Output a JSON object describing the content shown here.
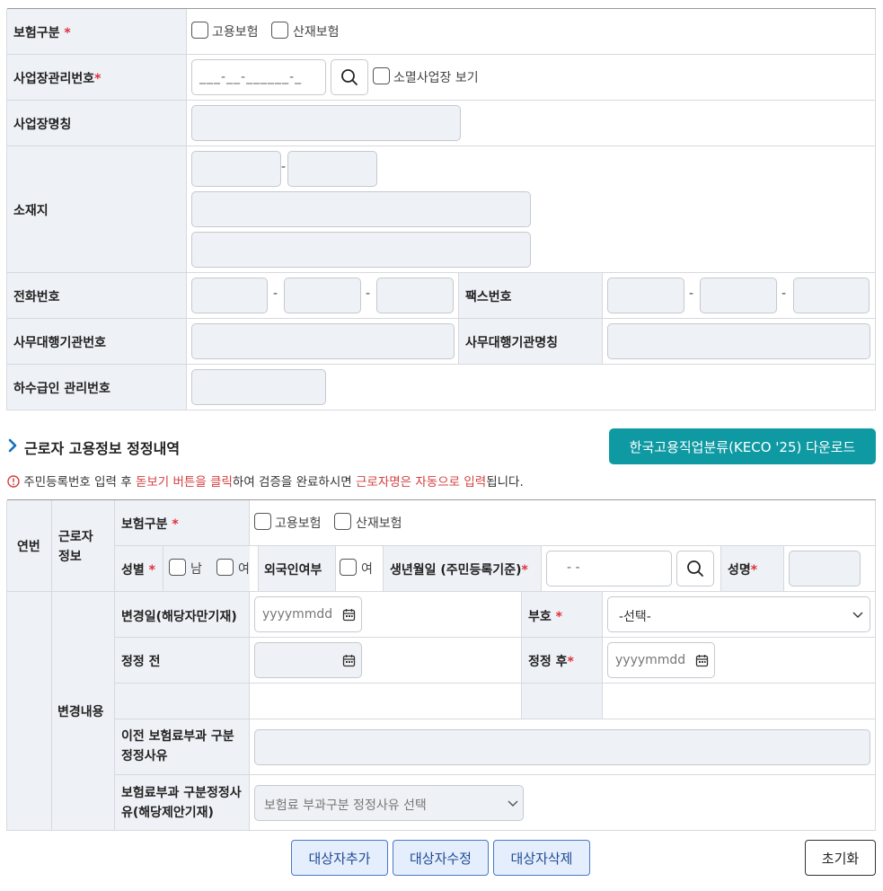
{
  "company": {
    "insurance_type_label": "보험구분",
    "insurance_option_employment": "고용보험",
    "insurance_option_accident": "산재보험",
    "mgmt_no_label": "사업장관리번호",
    "mgmt_no_placeholder": "___-__-______-_",
    "show_closed_label": "소멸사업장 보기",
    "name_label": "사업장명칭",
    "address_label": "소재지",
    "phone_label": "전화번호",
    "fax_label": "팩스번호",
    "agency_no_label": "사무대행기관번호",
    "agency_name_label": "사무대행기관명칭",
    "sub_mgmt_label": "하수급인 관리번호",
    "dash": "-"
  },
  "section": {
    "title": "근로자 고용정보 정정내역",
    "download_button": "한국고용직업분류(KECO '25) 다운로드",
    "notice_1": "주민등록번호 입력 후 ",
    "notice_2": "돋보기 버튼을 클릭",
    "notice_3": "하여 검증을 완료하시면 ",
    "notice_4": "근로자명은 자동으로 입력",
    "notice_5": "됩니다."
  },
  "worker": {
    "seq_label": "연번",
    "worker_info_label": "근로자\n정보",
    "insurance_type_label": "보험구분",
    "insurance_option_employment": "고용보험",
    "insurance_option_accident": "산재보험",
    "gender_label": "성별",
    "gender_male": "남",
    "gender_female": "여",
    "foreigner_label": "외국인여부",
    "foreigner_option": "여",
    "birth_label": "생년월일 (주민등록기준)",
    "birth_placeholder": "- -",
    "name_label": "성명",
    "change_content_label": "변경내용",
    "change_date_label": "변경일(해당자만기재)",
    "date_placeholder": "yyyymmdd",
    "code_label": "부호",
    "code_select": "-선택-",
    "before_label": "정정 전",
    "after_label": "정정 후",
    "prev_reason_label": "이전 보험료부과 구분\n정정사유",
    "reason_label": "보험료부과 구분정정사\n유(해당제안기재)",
    "reason_select": "보험료 부과구분 정정사유 선택"
  },
  "actions": {
    "add": "대상자추가",
    "edit": "대상자수정",
    "delete": "대상자삭제",
    "reset": "초기화"
  },
  "colors": {
    "accent_teal": "#0f9aa3",
    "required_red": "#e0303a",
    "notice_red": "#d43f3f",
    "button_blue": "#4a79c7",
    "label_bg": "#eef1f5"
  }
}
